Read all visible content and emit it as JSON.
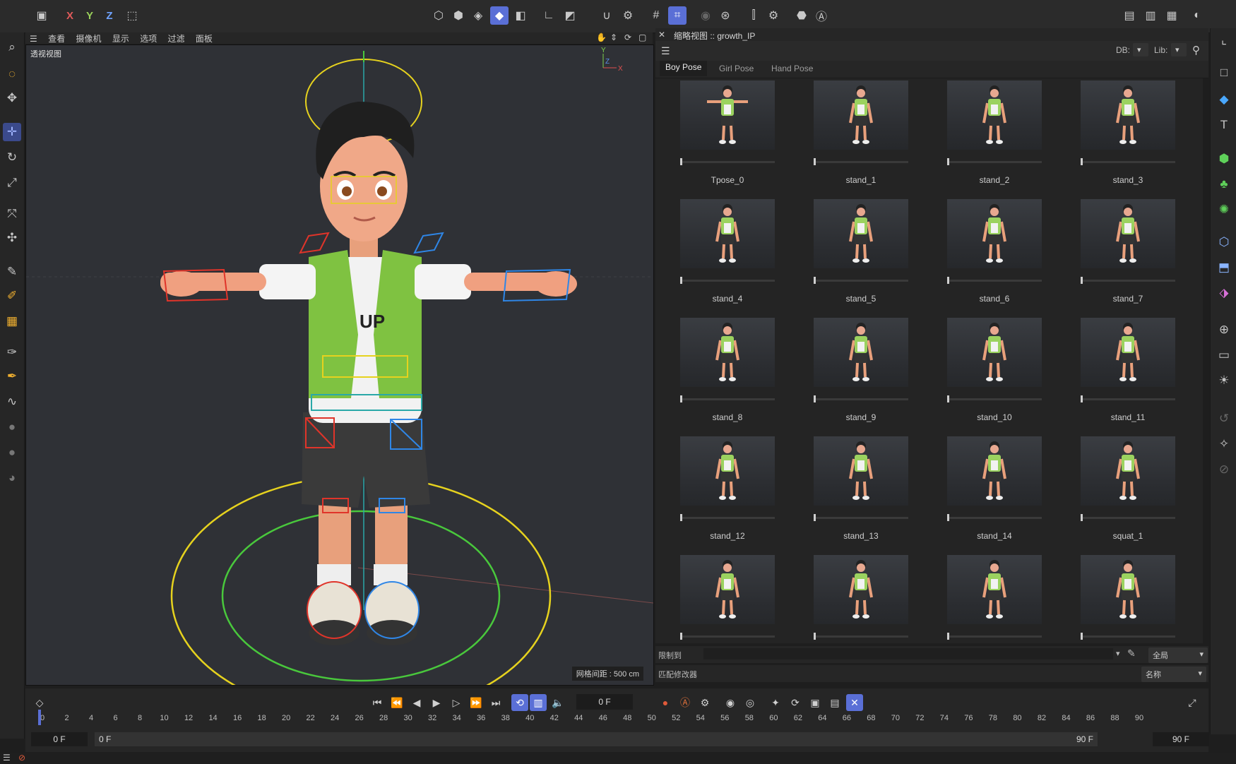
{
  "top_toolbar": {
    "axis_x": "X",
    "axis_y": "Y",
    "axis_z": "Z"
  },
  "viewport": {
    "menu": [
      "查看",
      "摄像机",
      "显示",
      "选项",
      "过滤",
      "面板"
    ],
    "name": "透视视图",
    "grid_spacing": "网格间距 : 500 cm",
    "axis_labels": {
      "y": "Y",
      "z": "Z",
      "x": "X"
    }
  },
  "asset_panel": {
    "title": "缩略视图 :: growth_IP",
    "db_label": "DB:",
    "lib_label": "Lib:",
    "tabs": [
      "Boy Pose",
      "Girl Pose",
      "Hand Pose"
    ],
    "active_tab": "Boy Pose",
    "poses": [
      "Tpose_0",
      "stand_1",
      "stand_2",
      "stand_3",
      "stand_4",
      "stand_5",
      "stand_6",
      "stand_7",
      "stand_8",
      "stand_9",
      "stand_10",
      "stand_11",
      "stand_12",
      "stand_13",
      "stand_14",
      "squat_1",
      "",
      "",
      "",
      ""
    ],
    "limit_label": "限制到",
    "limit_value": "全局",
    "match_label": "匹配修改器",
    "match_value": "名称"
  },
  "timeline": {
    "current_frame": "0 F",
    "start_field": "0 F",
    "start_field2": "0 F",
    "end_field": "90 F",
    "end_field2": "90 F",
    "ruler": [
      "0",
      "2",
      "4",
      "6",
      "8",
      "10",
      "12",
      "14",
      "16",
      "18",
      "20",
      "22",
      "24",
      "26",
      "28",
      "30",
      "32",
      "34",
      "36",
      "38",
      "40",
      "42",
      "44",
      "46",
      "48",
      "50",
      "52",
      "54",
      "56",
      "58",
      "60",
      "62",
      "64",
      "66",
      "68",
      "70",
      "72",
      "74",
      "76",
      "78",
      "80",
      "82",
      "84",
      "86",
      "88",
      "90"
    ]
  },
  "colors": {
    "accent": "#5a6fd6",
    "rig_yellow": "#e6d21e",
    "rig_green": "#49c83c",
    "rig_red": "#e0342a",
    "rig_blue": "#2f86e6",
    "vest_green": "#7fc241"
  }
}
